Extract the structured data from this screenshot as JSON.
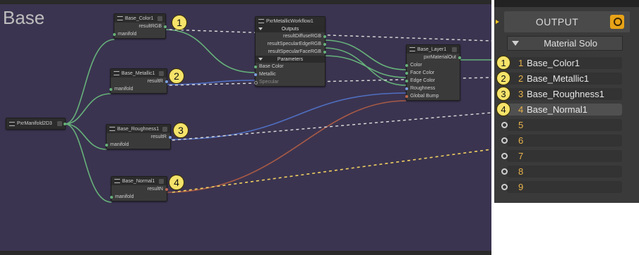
{
  "graph": {
    "title": "Base",
    "nodes": {
      "base_color": {
        "title": "Base_Color1",
        "output": "resultRGB",
        "input": "manifold"
      },
      "base_metallic": {
        "title": "Base_Metallic1",
        "output": "resultR",
        "input": "manifold"
      },
      "base_roughness": {
        "title": "Base_Roughness1",
        "output": "resultR",
        "input": "manifold"
      },
      "base_normal": {
        "title": "Base_Normal1",
        "output": "resultN",
        "input": "manifold"
      },
      "manifold": {
        "title": "PxrManifold2D3"
      },
      "metallic_workflow": {
        "title": "PxrMetallicWorkflow1",
        "outputs_header": "Outputs",
        "outputs": [
          "resultDiffuseRGB",
          "resultSpecularEdgeRGB",
          "resultSpecularFaceRGB"
        ],
        "params_header": "Parameters",
        "params": [
          "Base Color",
          "Metallic",
          "Specular"
        ]
      },
      "layer": {
        "title": "Base_Layer1",
        "output": "pxrMaterialOut",
        "inputs": [
          "Color",
          "Face Color",
          "Edge Color",
          "Roughness",
          "Global Bump"
        ]
      }
    },
    "badges": [
      "1",
      "2",
      "3",
      "4"
    ]
  },
  "panel": {
    "output_label": "OUTPUT",
    "mode_label": "Material Solo",
    "slots": [
      {
        "num": "1",
        "name": "Base_Color1",
        "badge": "1"
      },
      {
        "num": "2",
        "name": "Base_Metallic1",
        "badge": "2"
      },
      {
        "num": "3",
        "name": "Base_Roughness1",
        "badge": "3"
      },
      {
        "num": "4",
        "name": "Base_Normal1",
        "badge": "4",
        "selected": true
      },
      {
        "num": "5",
        "name": ""
      },
      {
        "num": "6",
        "name": ""
      },
      {
        "num": "7",
        "name": ""
      },
      {
        "num": "8",
        "name": ""
      },
      {
        "num": "9",
        "name": ""
      }
    ]
  },
  "colors": {
    "graph_bg": "#3b3450",
    "wire_green": "#66b27a",
    "wire_blue": "#4f6fc2",
    "wire_orange": "#a85a45",
    "badge": "#f5e36a",
    "slot_number": "#e9b34c"
  }
}
